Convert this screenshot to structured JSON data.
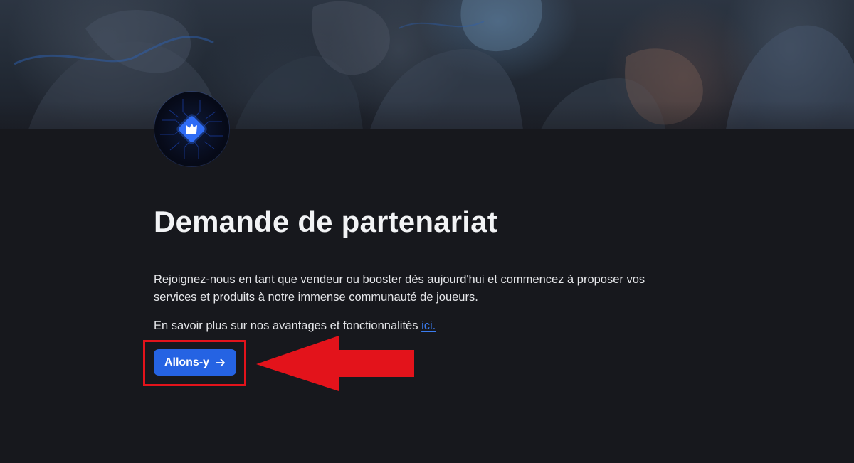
{
  "hero": {
    "image": "game-artwork-banner"
  },
  "logo": {
    "icon": "crown-diamond-icon",
    "accent_color": "#2f6cf5"
  },
  "main": {
    "title": "Demande de partenariat",
    "description": "Rejoignez-nous en tant que vendeur ou booster dès aujourd'hui et commencez à proposer vos services et produits à notre immense communauté de joueurs.",
    "learn_more_text": "En savoir plus sur nos avantages et fonctionnalités",
    "learn_more_link": "ici.",
    "cta_label": "Allons-y",
    "cta_icon": "arrow-right-icon"
  },
  "colors": {
    "background": "#17181d",
    "primary_button": "#2563e3",
    "link": "#3b7cf0",
    "annotation": "#e3131b"
  },
  "annotation": {
    "type": "red-arrow-highlight",
    "target": "cta-button"
  }
}
